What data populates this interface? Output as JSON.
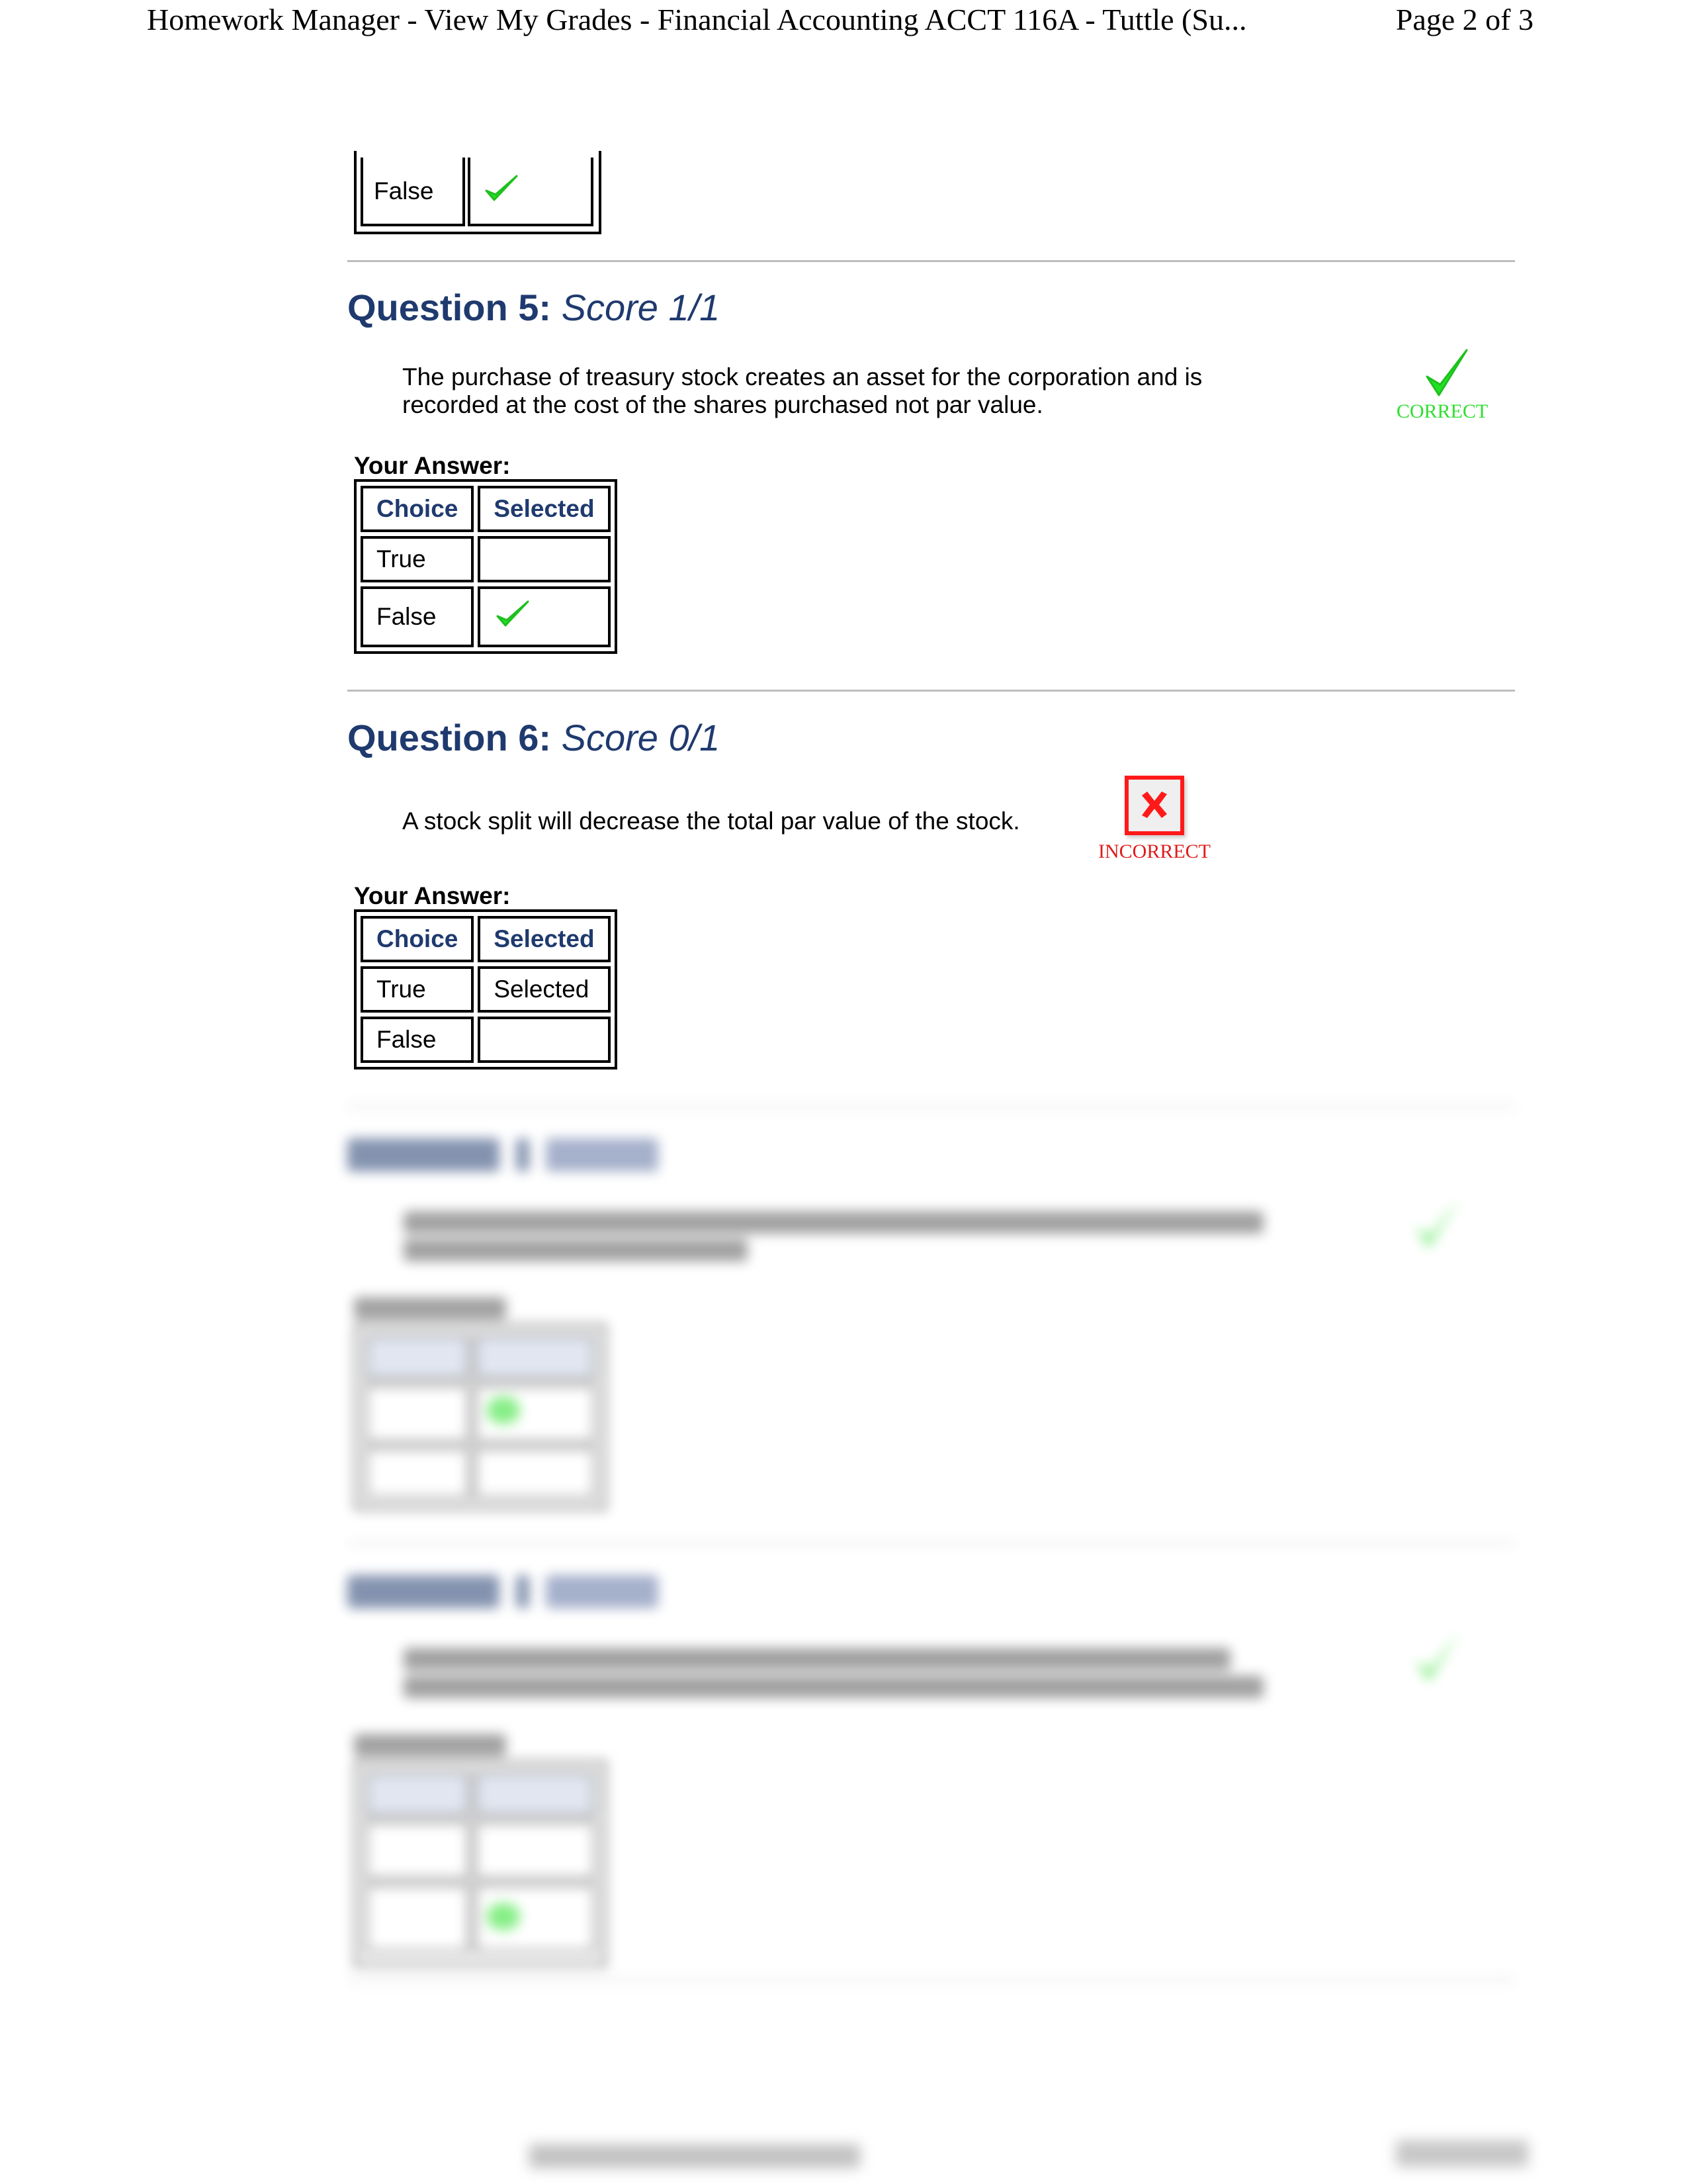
{
  "print_header": {
    "title": "Homework Manager - View My Grades - Financial Accounting ACCT 116A - Tuttle (Su...",
    "page": "Page 2 of 3"
  },
  "colors": {
    "heading_blue": "#1f3a6e",
    "correct_green": "#2fe02f",
    "incorrect_red": "#e01c1c"
  },
  "q4_tail": {
    "rows": [
      {
        "choice": "False",
        "selected": "check-icon"
      }
    ]
  },
  "questions": [
    {
      "label": "Question 5:",
      "score": "Score 1/1",
      "text": "The purchase of treasury stock creates an asset for the corporation and is recorded at the cost of the shares purchased not par value.",
      "status": "CORRECT",
      "status_icon": "check-icon",
      "your_answer_label": "Your Answer:",
      "headers": [
        "Choice",
        "Selected"
      ],
      "rows": [
        {
          "choice": "True",
          "selected": ""
        },
        {
          "choice": "False",
          "selected": "check-icon"
        }
      ]
    },
    {
      "label": "Question 6:",
      "score": "Score 0/1",
      "text": "A stock split will decrease the total par value of the stock.",
      "status": "INCORRECT",
      "status_icon": "x-box-icon",
      "your_answer_label": "Your Answer:",
      "headers": [
        "Choice",
        "Selected"
      ],
      "rows": [
        {
          "choice": "True",
          "selected": "Selected"
        },
        {
          "choice": "False",
          "selected": ""
        }
      ]
    }
  ],
  "blurred_questions": [
    {
      "status_icon": "check-icon",
      "selected_row": 0
    },
    {
      "status_icon": "check-icon",
      "selected_row": 1
    }
  ]
}
